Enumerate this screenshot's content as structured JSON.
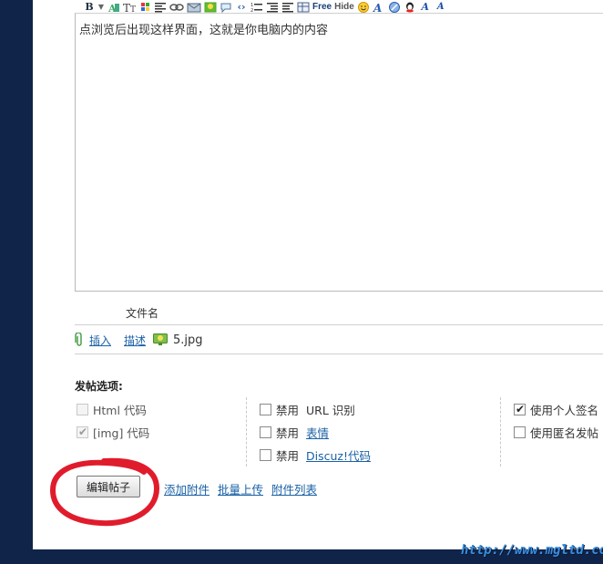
{
  "editor": {
    "content": "点浏览后出现这样界面，这就是你电脑内的内容",
    "toolbar": {
      "bold": "B",
      "free": "Free",
      "hide": "Hide",
      "font_a1": "A",
      "font_a2": "A"
    }
  },
  "attachments": {
    "header": "文件名",
    "insert_label": "插入",
    "describe_label": "描述",
    "file": "5.jpg"
  },
  "options": {
    "title": "发帖选项:",
    "col1": [
      {
        "label": "Html 代码",
        "checked": false,
        "disabled": true
      },
      {
        "label": "[img] 代码",
        "checked": true,
        "disabled": true
      }
    ],
    "col2": [
      {
        "prefix": "禁用",
        "label": "URL 识别",
        "link": false,
        "checked": false
      },
      {
        "prefix": "禁用",
        "label": "表情",
        "link": true,
        "checked": false
      },
      {
        "prefix": "禁用",
        "label": "Discuz!代码",
        "link": true,
        "checked": false
      }
    ],
    "col3": [
      {
        "label": "使用个人签名",
        "checked": true
      },
      {
        "label": "使用匿名发帖",
        "checked": false
      }
    ]
  },
  "actions": {
    "submit_label": "编辑帖子",
    "add_attachment": "添加附件",
    "batch_upload": "批量上传",
    "attachment_list": "附件列表"
  },
  "watermark": "http://www.mgltd.com",
  "colors": {
    "background": "#10244a",
    "link": "#1a61a6",
    "annotation_circle": "#e01c2c"
  }
}
